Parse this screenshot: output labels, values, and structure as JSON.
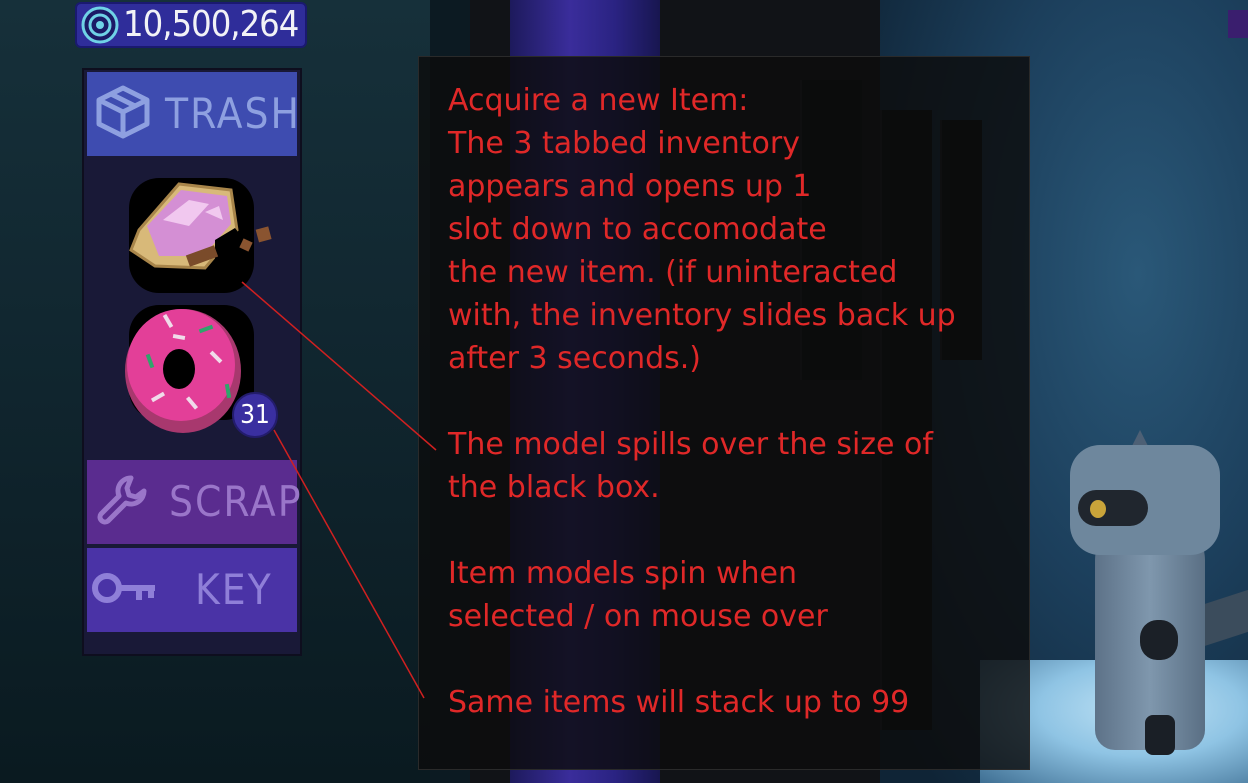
{
  "currency": {
    "icon": "coin-icon",
    "value": "10,500,264"
  },
  "inventory": {
    "tabs": {
      "trash": {
        "label": "TRASH",
        "icon": "box-icon"
      },
      "scrap": {
        "label": "SCRAP",
        "icon": "wrench-icon"
      },
      "key": {
        "label": "KEY",
        "icon": "key-icon"
      }
    },
    "slots": [
      {
        "item": "sandwich-bite-icon"
      },
      {
        "item": "donut-icon",
        "count": "31"
      }
    ]
  },
  "notes": {
    "acquire": "Acquire a new Item:\nThe 3 tabbed inventory\nappears and opens up 1\nslot down to accomodate\nthe new item. (if uninteracted\nwith, the inventory slides back up\nafter 3 seconds.)",
    "spill": "The model spills over the size of\nthe black box.",
    "spin": "Item models spin when\nselected / on mouse over",
    "stack": "Same items will stack up to 99"
  },
  "colors": {
    "annotation_text": "#e02828",
    "callout_line": "#d02020",
    "currency_bar": "#2f2d9a",
    "trash_tab": "#3e4cb0",
    "scrap_tab": "#5a2c8f",
    "key_tab": "#4a33a6",
    "stack_badge": "#3a2fa0"
  }
}
